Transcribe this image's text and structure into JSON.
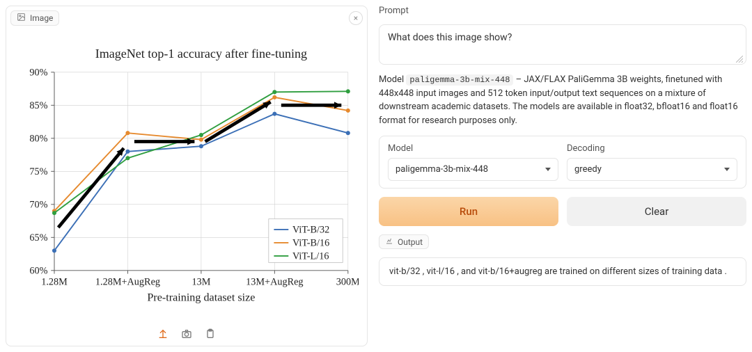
{
  "left": {
    "badge_label": "Image",
    "toolbar_icons": [
      "undo-icon",
      "camera-icon",
      "clipboard-icon"
    ]
  },
  "right": {
    "prompt_label": "Prompt",
    "prompt_value": "What does this image show?",
    "desc_prefix": "Model ",
    "desc_code": "paligemma-3b-mix-448",
    "desc_suffix": " – JAX/FLAX PaliGemma 3B weights, finetuned with 448x448 input images and 512 token input/output text sequences on a mixture of downstream academic datasets. The models are available in float32, bfloat16 and float16 format for research purposes only.",
    "model_label": "Model",
    "model_value": "paligemma-3b-mix-448",
    "decoding_label": "Decoding",
    "decoding_value": "greedy",
    "run_label": "Run",
    "clear_label": "Clear",
    "output_badge": "Output",
    "output_text": "vit-b/32 , vit-l/16 , and vit-b/16+augreg are trained on different sizes of training data ."
  },
  "chart_data": {
    "type": "line",
    "title": "ImageNet top-1 accuracy after fine-tuning",
    "xlabel": "Pre-training dataset size",
    "ylabel": "",
    "categories": [
      "1.28M",
      "1.28M+AugReg",
      "13M",
      "13M+AugReg",
      "300M"
    ],
    "ylim": [
      60,
      90
    ],
    "yticks": [
      60,
      65,
      70,
      75,
      80,
      85,
      90
    ],
    "ytick_labels": [
      "60%",
      "65%",
      "70%",
      "75%",
      "80%",
      "85%",
      "90%"
    ],
    "series": [
      {
        "name": "ViT-B/32",
        "color": "#3b6fb6",
        "values": [
          63.0,
          78.0,
          78.8,
          83.7,
          80.8
        ]
      },
      {
        "name": "ViT-B/16",
        "color": "#e68a2e",
        "values": [
          69.0,
          80.8,
          79.8,
          86.2,
          84.2
        ]
      },
      {
        "name": "ViT-L/16",
        "color": "#2f9e3f",
        "values": [
          68.7,
          77.0,
          80.5,
          87.0,
          87.1
        ]
      }
    ],
    "annotations": "four black annotation arrows drawn over the lines indicating upward/rightward trends between adjacent category pairs"
  }
}
